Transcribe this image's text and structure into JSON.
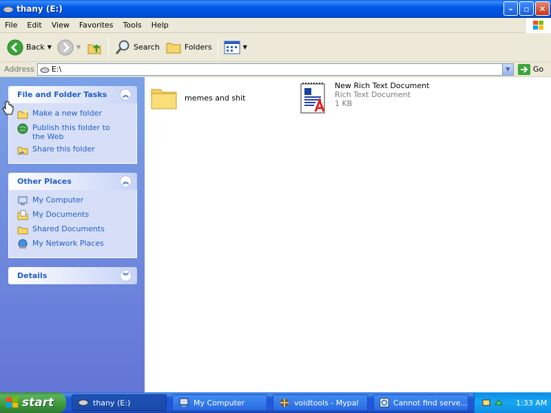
{
  "window": {
    "title": "thany (E:)",
    "buttons": [
      "minimize",
      "maximize",
      "close"
    ]
  },
  "menu": [
    "File",
    "Edit",
    "View",
    "Favorites",
    "Tools",
    "Help"
  ],
  "toolbar": {
    "back_label": "Back",
    "search_label": "Search",
    "folders_label": "Folders"
  },
  "address": {
    "label": "Address",
    "value": "E:\\",
    "go_label": "Go"
  },
  "tasks": {
    "file_folder": {
      "title": "File and Folder Tasks",
      "items": [
        "Make a new folder",
        "Publish this folder to the Web",
        "Share this folder"
      ]
    },
    "other_places": {
      "title": "Other Places",
      "items": [
        "My Computer",
        "My Documents",
        "Shared Documents",
        "My Network Places"
      ]
    },
    "details": {
      "title": "Details"
    }
  },
  "files": [
    {
      "name": "memes and shit",
      "type": "",
      "size": ""
    },
    {
      "name": "New Rich Text Document",
      "type": "Rich Text Document",
      "size": "1 KB"
    }
  ],
  "taskbar": {
    "start_label": "start",
    "tasks": [
      "thany (E:)",
      "My Computer",
      "voidtools - Mypal",
      "Cannot find serve..."
    ],
    "clock": "1:33 AM"
  },
  "colors": {
    "title_blue": "#0058e6",
    "task_link": "#215dc6",
    "start_green": "#3e9a3e"
  }
}
